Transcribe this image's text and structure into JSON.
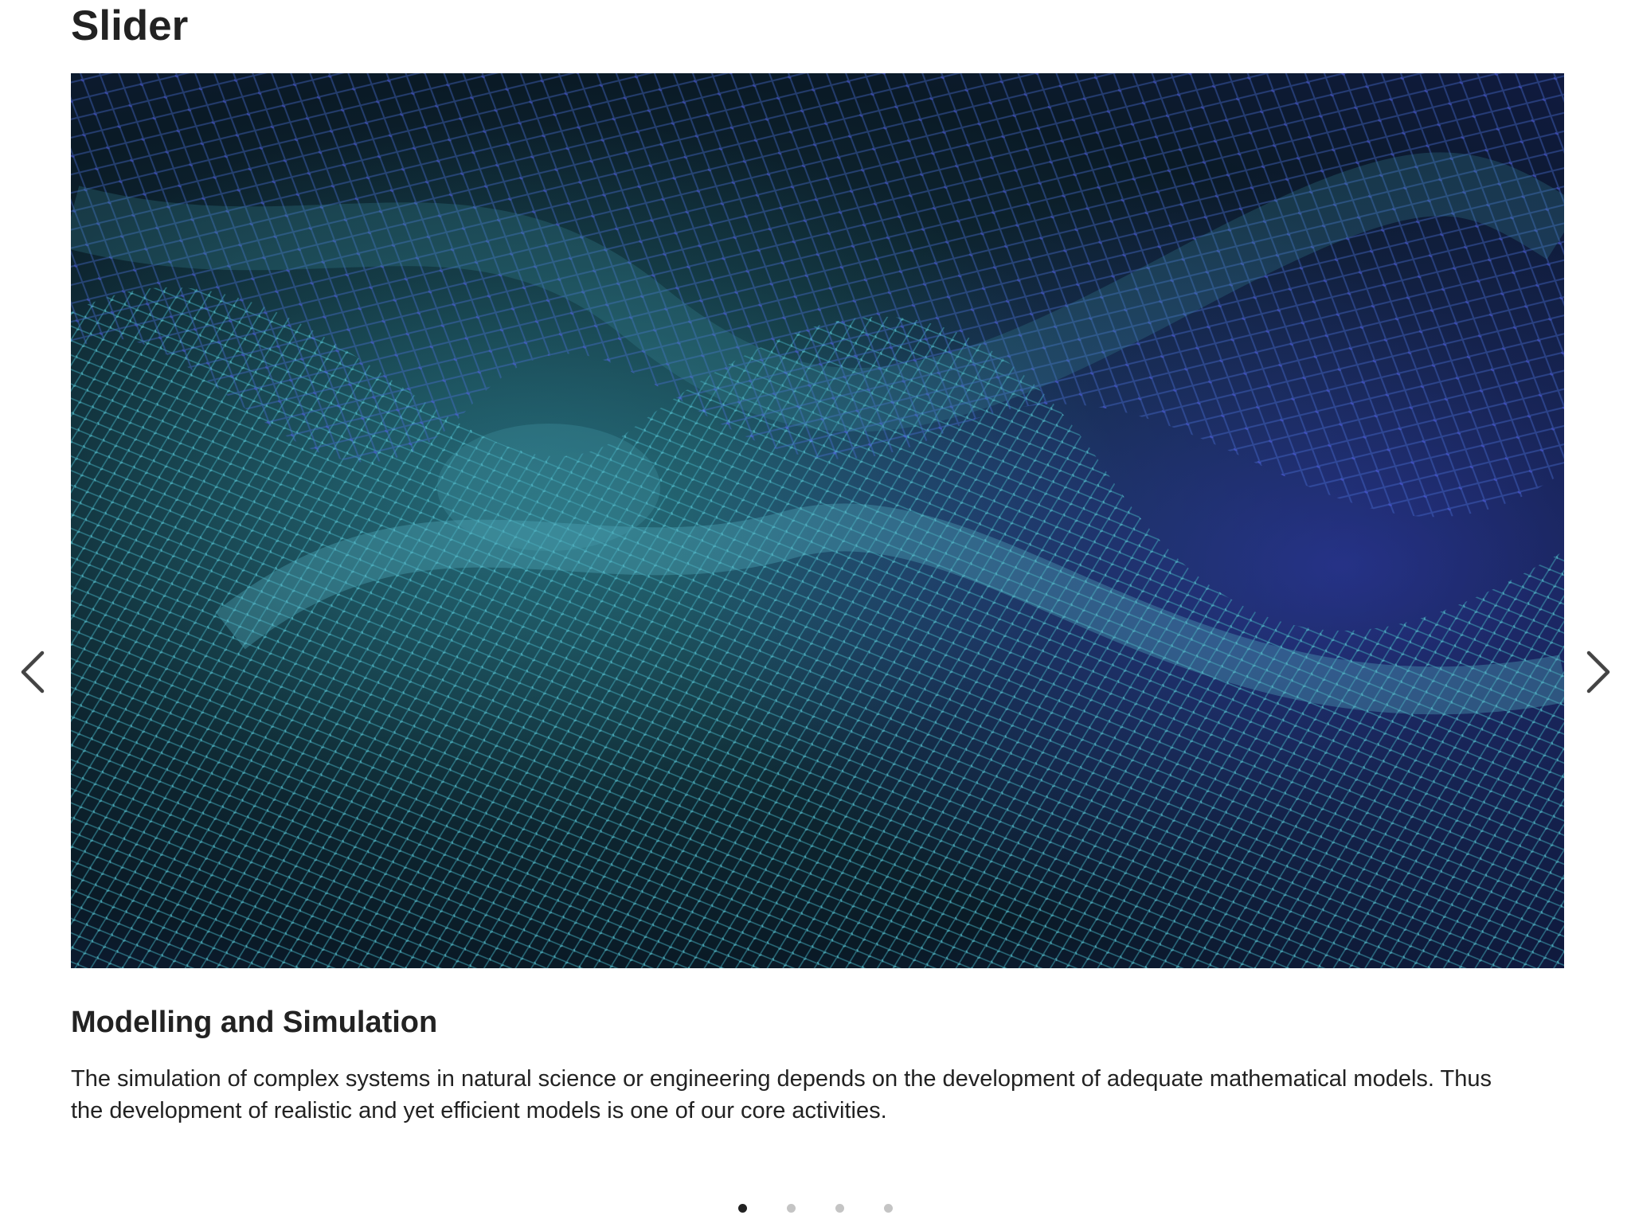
{
  "page": {
    "title": "Slider"
  },
  "slider": {
    "prev_icon": "chevron-left-icon",
    "next_icon": "chevron-right-icon",
    "image_colors": [
      "#0a1a26",
      "#1f5563",
      "#3fa8b8",
      "#3a3fd0"
    ],
    "active_slide": 1,
    "slide_count": 4,
    "slide": {
      "title": "Modelling and Simulation",
      "text": "The simulation of complex systems in natural science or engineering depends on the development of adequate mathematical models. Thus the development of realistic and yet efficient models is one of our core activities."
    }
  }
}
